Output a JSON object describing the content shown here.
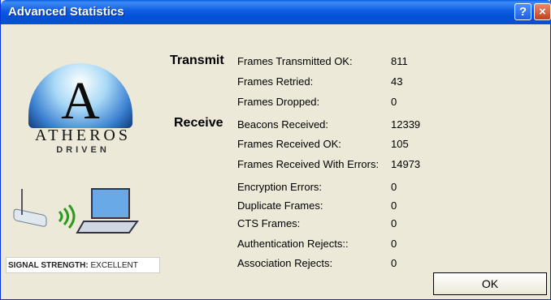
{
  "window": {
    "title": "Advanced Statistics",
    "help_glyph": "?",
    "close_glyph": "×"
  },
  "logo": {
    "brand": "ATHEROS",
    "sub": "DRIVEN",
    "glyph": "A"
  },
  "signal": {
    "label": "SIGNAL STRENGTH:",
    "value": "EXCELLENT"
  },
  "transmit": {
    "heading": "Transmit",
    "rows": [
      {
        "label": "Frames Transmitted OK:",
        "value": "811"
      },
      {
        "label": "Frames Retried:",
        "value": "43"
      },
      {
        "label": "Frames Dropped:",
        "value": "0"
      }
    ]
  },
  "receive": {
    "heading": "Receive",
    "rows": [
      {
        "label": "Beacons Received:",
        "value": "12339"
      },
      {
        "label": "Frames Received OK:",
        "value": "105"
      },
      {
        "label": "Frames Received With Errors:",
        "value": "14973"
      },
      {
        "label": "Encryption Errors:",
        "value": "0"
      },
      {
        "label": "Duplicate Frames:",
        "value": "0"
      },
      {
        "label": "CTS Frames:",
        "value": "0"
      },
      {
        "label": "Authentication Rejects::",
        "value": "0"
      },
      {
        "label": "Association Rejects:",
        "value": "0"
      }
    ]
  },
  "buttons": {
    "ok": "OK"
  }
}
